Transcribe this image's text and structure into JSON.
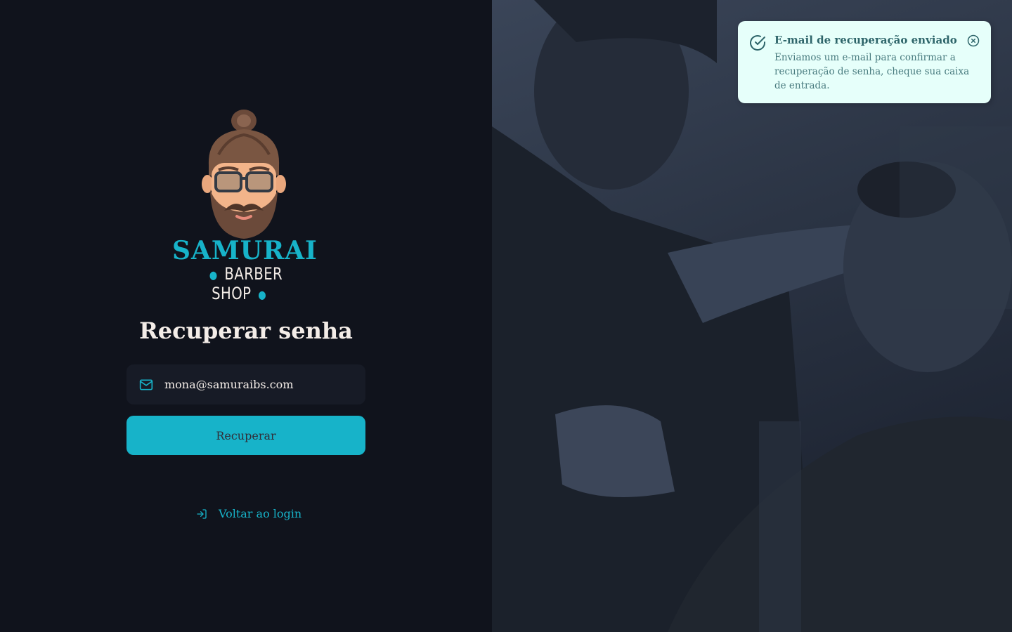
{
  "brand": {
    "name": "SAMURAI",
    "tagline": "BARBER SHOP",
    "icon": "barber-mascot-logo"
  },
  "form": {
    "title": "Recuperar senha",
    "email_value": "mona@samuraibs.com",
    "email_icon": "mail-icon",
    "submit_label": "Recuperar",
    "back_link_label": "Voltar ao login",
    "back_link_icon": "log-in-icon"
  },
  "toast": {
    "title": "E-mail de recuperação enviado",
    "description": "Enviamos um e-mail para confirmar a recuperação de senha, cheque sua caixa de entrada.",
    "type": "success",
    "icon": "check-circle-icon",
    "close_icon": "x-circle-icon"
  },
  "colors": {
    "accent": "#17b3c9",
    "background": "#10131c",
    "input_background": "#171b26",
    "text": "#f4ede8",
    "toast_background": "#e6fffa",
    "toast_text": "#2e656a"
  }
}
